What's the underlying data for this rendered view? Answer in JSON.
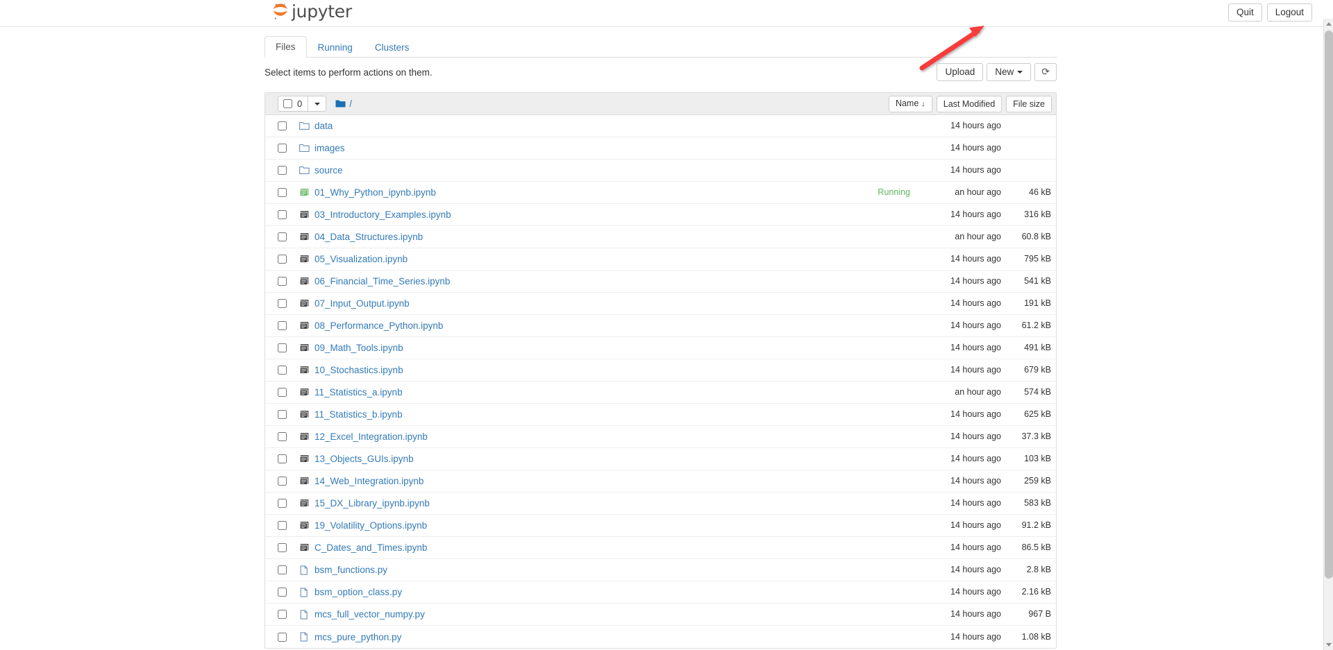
{
  "header": {
    "brand": "jupyter",
    "logo_icon": "jupyter-logo-icon",
    "logo_color": "#f37726",
    "quit_label": "Quit",
    "logout_label": "Logout"
  },
  "tabs": [
    {
      "label": "Files",
      "active": true
    },
    {
      "label": "Running",
      "active": false
    },
    {
      "label": "Clusters",
      "active": false
    }
  ],
  "toolbar": {
    "message": "Select items to perform actions on them.",
    "upload_label": "Upload",
    "new_label": "New",
    "refresh_icon": "refresh-icon",
    "refresh_glyph": "⟳"
  },
  "list_header": {
    "selected_count": "0",
    "breadcrumb_path": "/",
    "folder_icon": "folder-icon",
    "columns": [
      {
        "label": "Name",
        "sort_arrow": "↓"
      },
      {
        "label": "Last Modified",
        "sort_arrow": ""
      },
      {
        "label": "File size",
        "sort_arrow": ""
      }
    ]
  },
  "accent": {
    "link_color": "#337ab7",
    "running_color": "#5cb85c",
    "folder_color": "#1a6fb5",
    "notebook_running_color": "#5cb85c",
    "notebook_color": "#333333",
    "annotation_color": "#f93c3c"
  },
  "files": [
    {
      "name": "data",
      "type": "folder",
      "modified": "14 hours ago",
      "size": "",
      "running": ""
    },
    {
      "name": "images",
      "type": "folder",
      "modified": "14 hours ago",
      "size": "",
      "running": ""
    },
    {
      "name": "source",
      "type": "folder",
      "modified": "14 hours ago",
      "size": "",
      "running": ""
    },
    {
      "name": "01_Why_Python_ipynb.ipynb",
      "type": "notebook-running",
      "modified": "an hour ago",
      "size": "46 kB",
      "running": "Running"
    },
    {
      "name": "03_Introductory_Examples.ipynb",
      "type": "notebook",
      "modified": "14 hours ago",
      "size": "316 kB",
      "running": ""
    },
    {
      "name": "04_Data_Structures.ipynb",
      "type": "notebook",
      "modified": "an hour ago",
      "size": "60.8 kB",
      "running": ""
    },
    {
      "name": "05_Visualization.ipynb",
      "type": "notebook",
      "modified": "14 hours ago",
      "size": "795 kB",
      "running": ""
    },
    {
      "name": "06_Financial_Time_Series.ipynb",
      "type": "notebook",
      "modified": "14 hours ago",
      "size": "541 kB",
      "running": ""
    },
    {
      "name": "07_Input_Output.ipynb",
      "type": "notebook",
      "modified": "14 hours ago",
      "size": "191 kB",
      "running": ""
    },
    {
      "name": "08_Performance_Python.ipynb",
      "type": "notebook",
      "modified": "14 hours ago",
      "size": "61.2 kB",
      "running": ""
    },
    {
      "name": "09_Math_Tools.ipynb",
      "type": "notebook",
      "modified": "14 hours ago",
      "size": "491 kB",
      "running": ""
    },
    {
      "name": "10_Stochastics.ipynb",
      "type": "notebook",
      "modified": "14 hours ago",
      "size": "679 kB",
      "running": ""
    },
    {
      "name": "11_Statistics_a.ipynb",
      "type": "notebook",
      "modified": "an hour ago",
      "size": "574 kB",
      "running": ""
    },
    {
      "name": "11_Statistics_b.ipynb",
      "type": "notebook",
      "modified": "14 hours ago",
      "size": "625 kB",
      "running": ""
    },
    {
      "name": "12_Excel_Integration.ipynb",
      "type": "notebook",
      "modified": "14 hours ago",
      "size": "37.3 kB",
      "running": ""
    },
    {
      "name": "13_Objects_GUIs.ipynb",
      "type": "notebook",
      "modified": "14 hours ago",
      "size": "103 kB",
      "running": ""
    },
    {
      "name": "14_Web_Integration.ipynb",
      "type": "notebook",
      "modified": "14 hours ago",
      "size": "259 kB",
      "running": ""
    },
    {
      "name": "15_DX_Library_ipynb.ipynb",
      "type": "notebook",
      "modified": "14 hours ago",
      "size": "583 kB",
      "running": ""
    },
    {
      "name": "19_Volatility_Options.ipynb",
      "type": "notebook",
      "modified": "14 hours ago",
      "size": "91.2 kB",
      "running": ""
    },
    {
      "name": "C_Dates_and_Times.ipynb",
      "type": "notebook",
      "modified": "14 hours ago",
      "size": "86.5 kB",
      "running": ""
    },
    {
      "name": "bsm_functions.py",
      "type": "file",
      "modified": "14 hours ago",
      "size": "2.8 kB",
      "running": ""
    },
    {
      "name": "bsm_option_class.py",
      "type": "file",
      "modified": "14 hours ago",
      "size": "2.16 kB",
      "running": ""
    },
    {
      "name": "mcs_full_vector_numpy.py",
      "type": "file",
      "modified": "14 hours ago",
      "size": "967 B",
      "running": ""
    },
    {
      "name": "mcs_pure_python.py",
      "type": "file",
      "modified": "14 hours ago",
      "size": "1.08 kB",
      "running": ""
    }
  ],
  "annotation": {
    "type": "arrow",
    "points_to": "Quit",
    "color": "#f93c3c"
  },
  "scrollbar": {
    "up_arrow": "scroll-up-icon",
    "down_arrow": "scroll-down-icon"
  }
}
